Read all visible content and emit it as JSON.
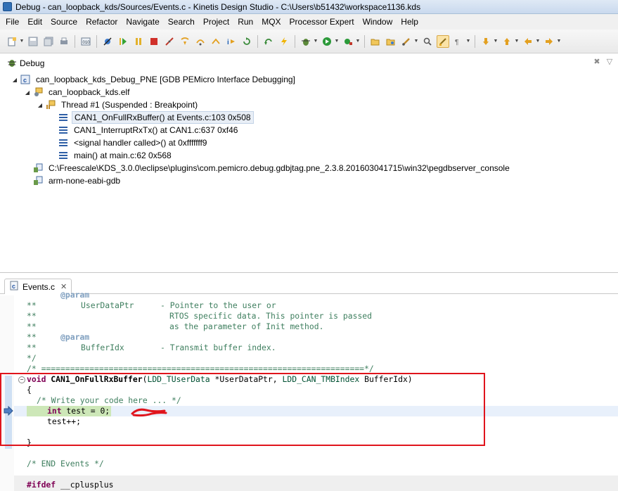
{
  "window": {
    "title": "Debug - can_loopback_kds/Sources/Events.c - Kinetis Design Studio - C:\\Users\\b51432\\workspace1136.kds"
  },
  "menu": [
    "File",
    "Edit",
    "Source",
    "Refactor",
    "Navigate",
    "Search",
    "Project",
    "Run",
    "MQX",
    "Processor Expert",
    "Window",
    "Help"
  ],
  "debug_view": {
    "tab_label": "Debug",
    "tree": {
      "launch": "can_loopback_kds_Debug_PNE [GDB PEMicro Interface Debugging]",
      "elf": "can_loopback_kds.elf",
      "thread": "Thread #1 (Suspended : Breakpoint)",
      "frames": [
        "CAN1_OnFullRxBuffer() at Events.c:103 0x508",
        "CAN1_InterruptRxTx() at CAN1.c:637 0xf46",
        "<signal handler called>() at 0xfffffff9",
        "main() at main.c:62 0x568"
      ],
      "server": "C:\\Freescale\\KDS_3.0.0\\eclipse\\plugins\\com.pemicro.debug.gdbjtag.pne_2.3.8.201603041715\\win32\\pegdbserver_console",
      "gdb": "arm-none-eabi-gdb"
    }
  },
  "editor": {
    "tab_label": "Events.c",
    "code": {
      "l1_tag": "@param",
      "l2_star": "**",
      "l2_name": "UserDataPtr",
      "l2_desc": "- Pointer to the user or",
      "l3_star": "**",
      "l3_desc": "RTOS specific data. This pointer is passed",
      "l4_star": "**",
      "l4_desc": "as the parameter of Init method.",
      "l5_star": "**",
      "l5_tag": "@param",
      "l6_star": "**",
      "l6_name": "BufferIdx",
      "l6_desc": "- Transmit buffer index.",
      "l7": "*/",
      "l8": "/* ===================================================================*/",
      "l9_kw": "void",
      "l9_fn": "CAN1_OnFullRxBuffer",
      "l9_p1": "(",
      "l9_t1": "LDD_TUserData",
      "l9_p2": " *UserDataPtr, ",
      "l9_t2": "LDD_CAN_TMBIndex",
      "l9_p3": " BufferIdx)",
      "l10": "{",
      "l11": "/* Write your code here ... */",
      "l12_kw": "int",
      "l12_rest": " test = 0;",
      "l13": "test++;",
      "l14": "}",
      "l15": "/* END Events */",
      "l16_pp": "#ifdef",
      "l16_rest": " __cplusplus"
    }
  },
  "colors": {
    "annotation_red": "#e0141c",
    "current_line": "#cde7b8",
    "comment_green": "#3f7f5f",
    "keyword_purple": "#7f0055"
  }
}
